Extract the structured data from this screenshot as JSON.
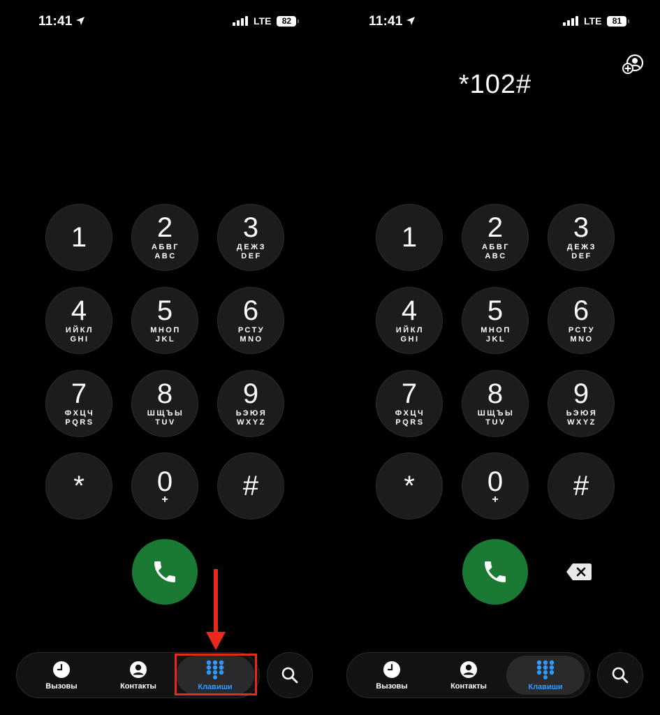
{
  "accent_color": "#2f9bff",
  "call_color": "#1a7a34",
  "annotation_color": "#e82a1e",
  "left": {
    "status": {
      "time": "11:41",
      "network": "LTE",
      "battery": "82"
    },
    "tabs": [
      {
        "label": "Вызовы",
        "icon": "clock-icon"
      },
      {
        "label": "Контакты",
        "icon": "person-icon"
      },
      {
        "label": "Клавиши",
        "icon": "keypad-icon"
      }
    ]
  },
  "right": {
    "status": {
      "time": "11:41",
      "network": "LTE",
      "battery": "81"
    },
    "entered_number": "*102#",
    "tabs": [
      {
        "label": "Вызовы",
        "icon": "clock-icon"
      },
      {
        "label": "Контакты",
        "icon": "person-icon"
      },
      {
        "label": "Клавиши",
        "icon": "keypad-icon"
      }
    ]
  },
  "keys": [
    {
      "digit": "1",
      "cyr": "",
      "lat": ""
    },
    {
      "digit": "2",
      "cyr": "АБВГ",
      "lat": "ABC"
    },
    {
      "digit": "3",
      "cyr": "ДЕЖЗ",
      "lat": "DEF"
    },
    {
      "digit": "4",
      "cyr": "ИЙКЛ",
      "lat": "GHI"
    },
    {
      "digit": "5",
      "cyr": "МНОП",
      "lat": "JKL"
    },
    {
      "digit": "6",
      "cyr": "РСТУ",
      "lat": "MNO"
    },
    {
      "digit": "7",
      "cyr": "ФХЦЧ",
      "lat": "PQRS"
    },
    {
      "digit": "8",
      "cyr": "ШЩЪЫ",
      "lat": "TUV"
    },
    {
      "digit": "9",
      "cyr": "ЬЭЮЯ",
      "lat": "WXYZ"
    },
    {
      "digit": "*",
      "cyr": "",
      "lat": ""
    },
    {
      "digit": "0",
      "cyr": "+",
      "lat": ""
    },
    {
      "digit": "#",
      "cyr": "",
      "lat": ""
    }
  ]
}
